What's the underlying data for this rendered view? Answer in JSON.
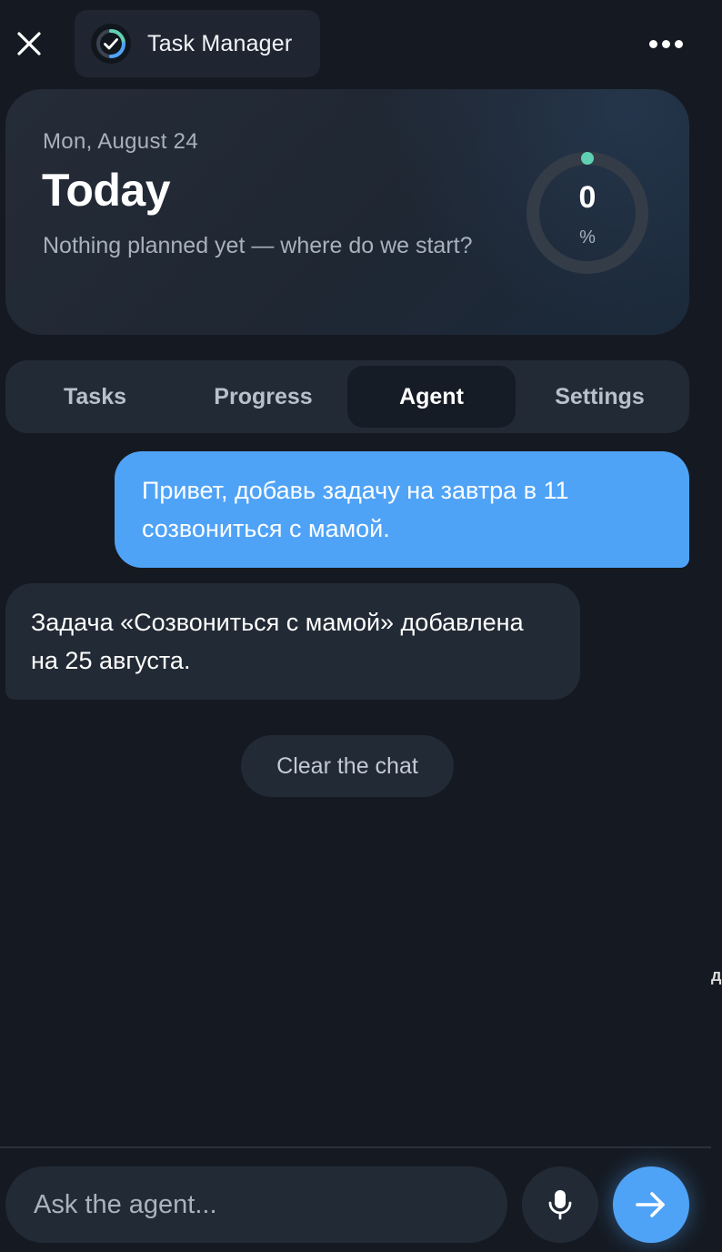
{
  "app": {
    "title": "Task Manager",
    "accent_color": "#4fa3f7",
    "ring_accent_color": "#5fd0b4",
    "icons": {
      "close": "close-icon",
      "logo": "check-circle-logo",
      "more": "more-dots-icon",
      "mic": "microphone-icon",
      "send": "arrow-right-icon"
    }
  },
  "today": {
    "date": "Mon, August 24",
    "title": "Today",
    "subtitle": "Nothing planned yet — where do we start?",
    "progress_value": "0",
    "progress_unit": "%",
    "progress_percent": 0
  },
  "tabs": [
    {
      "label": "Tasks",
      "active": false
    },
    {
      "label": "Progress",
      "active": false
    },
    {
      "label": "Agent",
      "active": true
    },
    {
      "label": "Settings",
      "active": false
    }
  ],
  "chat": {
    "messages": [
      {
        "role": "user",
        "text": "Привет, добавь задачу на завтра в 11 созвониться с мамой."
      },
      {
        "role": "agent",
        "text": "Задача «Созвониться с мамой» добавлена на 25 августа."
      }
    ],
    "clear_label": "Clear the chat"
  },
  "edge_text": "д",
  "input": {
    "placeholder": "Ask the agent...",
    "value": ""
  }
}
